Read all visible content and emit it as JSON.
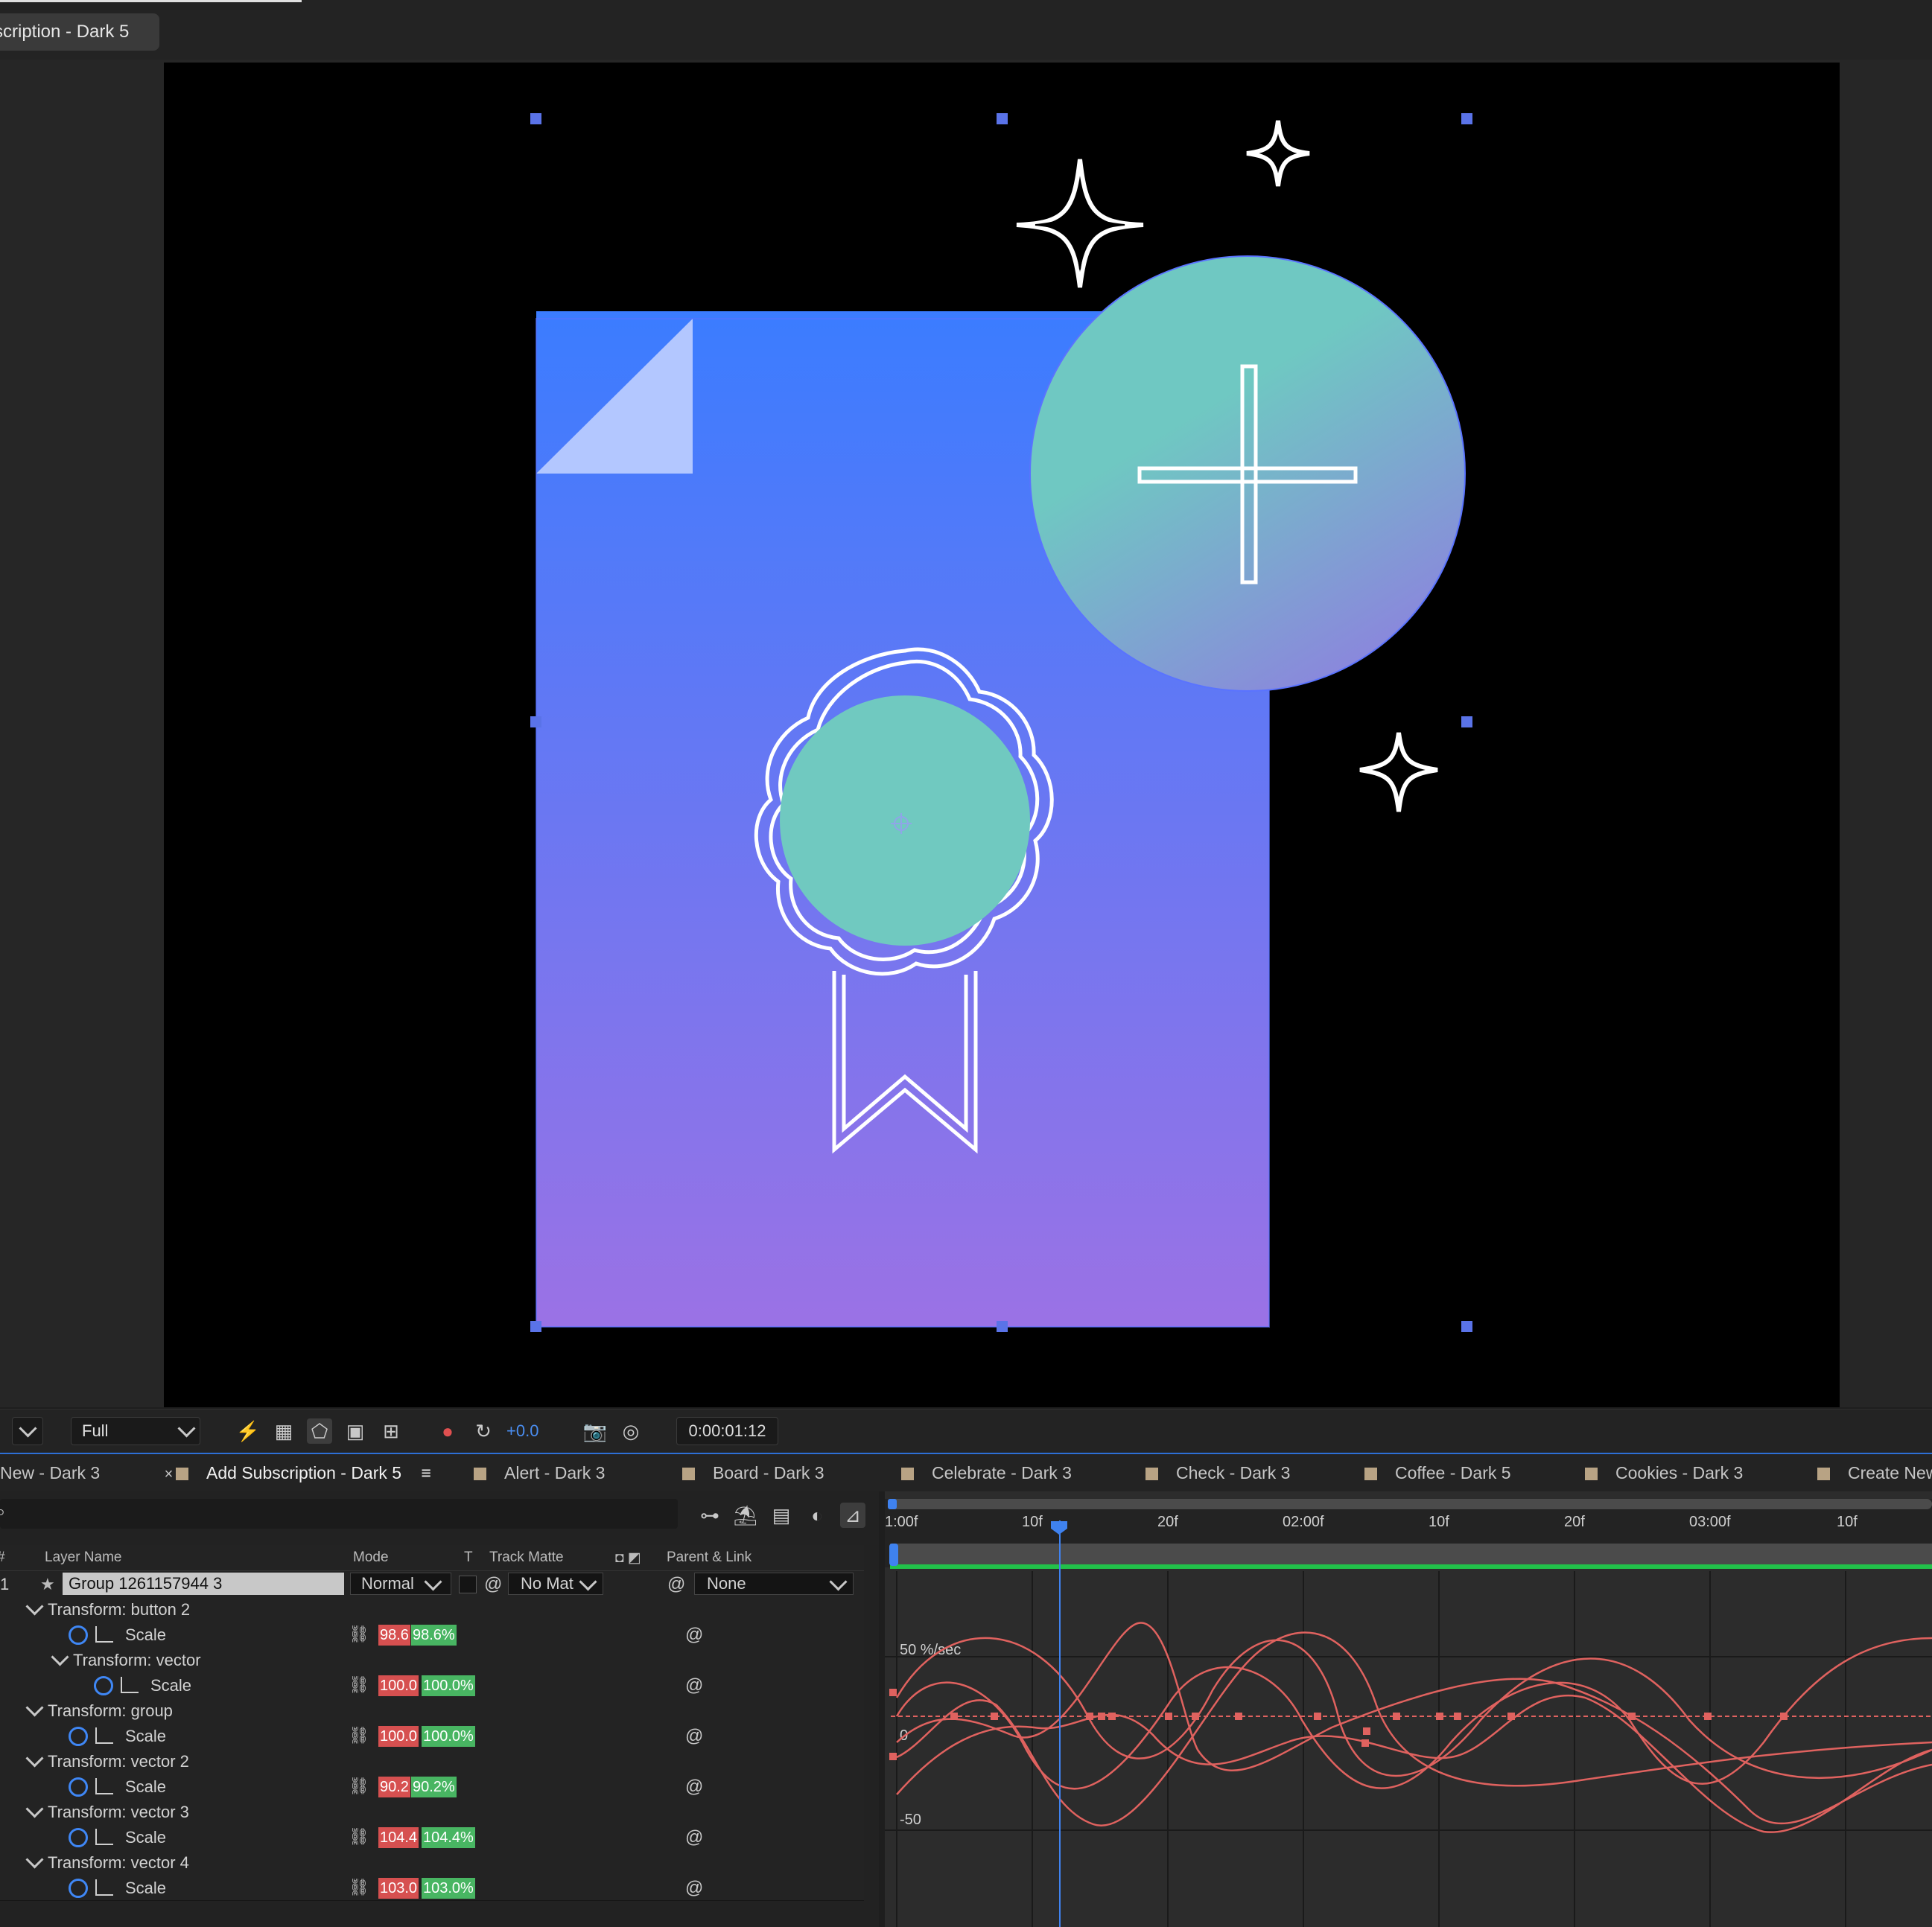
{
  "composition_tab": {
    "label": "scription - Dark 5"
  },
  "viewer_toolbar": {
    "resolution": "Full",
    "exposure": "+0.0",
    "timecode": "0:00:01:12"
  },
  "timeline_tabs": [
    {
      "label": "New - Dark 3",
      "close": "×"
    },
    {
      "label": "Add Subscription - Dark 5",
      "menu": "≡"
    },
    {
      "label": "Alert - Dark 3"
    },
    {
      "label": "Board - Dark 3"
    },
    {
      "label": "Celebrate - Dark 3"
    },
    {
      "label": "Check - Dark 3"
    },
    {
      "label": "Coffee - Dark 5"
    },
    {
      "label": "Cookies - Dark 3"
    },
    {
      "label": "Create New"
    }
  ],
  "columns": {
    "num": "#",
    "layer_name": "Layer Name",
    "mode": "Mode",
    "t": "T",
    "track_matte": "Track Matte",
    "parent_link": "Parent & Link"
  },
  "layer": {
    "index": "1",
    "name": "Group 1261157944 3",
    "mode": "Normal",
    "track_matte": "No Mat",
    "parent": "None"
  },
  "properties": [
    {
      "group": "Transform: button 2",
      "prop": "Scale",
      "x": "98.6",
      "y": "98.6%"
    },
    {
      "group": "Transform: vector",
      "prop": "Scale",
      "x": "100.0",
      "y": "100.0%"
    },
    {
      "group": "Transform: group",
      "prop": "Scale",
      "x": "100.0",
      "y": "100.0%"
    },
    {
      "group": "Transform: vector 2",
      "prop": "Scale",
      "x": "90.2",
      "y": "90.2%"
    },
    {
      "group": "Transform: vector 3",
      "prop": "Scale",
      "x": "104.4",
      "y": "104.4%"
    },
    {
      "group": "Transform: vector 4",
      "prop": "Scale",
      "x": "103.0",
      "y": "103.0%"
    }
  ],
  "ruler": [
    "1:00f",
    "10f",
    "20f",
    "02:00f",
    "10f",
    "20f",
    "03:00f",
    "10f"
  ],
  "graph": {
    "unit_label": "50 %/sec",
    "zero": "0",
    "neg": "-50"
  },
  "colors": {
    "accent": "#3f82ef",
    "curve": "#e0625f",
    "doc_top": "#3b7cff",
    "doc_bottom": "#9a72e6",
    "teal": "#70c9c0"
  }
}
